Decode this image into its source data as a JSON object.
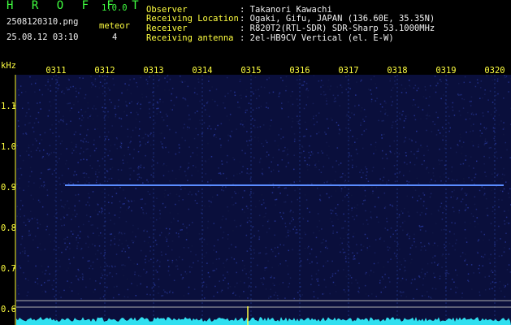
{
  "app": {
    "name": "H R O F F T",
    "version": "1.0.0",
    "file": "2508120310.png",
    "datetime": "25.08.12 03:10",
    "meteor_label": "meteor",
    "meteor_count": "4"
  },
  "info": [
    {
      "label": "Observer",
      "value": ": Takanori Kawachi"
    },
    {
      "label": "Receiving Location",
      "value": ": Ogaki, Gifu, JAPAN (136.60E, 35.35N)"
    },
    {
      "label": "Receiver",
      "value": ": R820T2(RTL-SDR) SDR-Sharp 53.1000MHz"
    },
    {
      "label": "Receiving antenna",
      "value": ": 2el-HB9CV Vertical (el. E-W)"
    }
  ],
  "axis": {
    "y_unit": "kHz",
    "y_ticks": [
      "1.1",
      "1.0",
      "0.9",
      "0.8",
      "0.7",
      "0.6"
    ],
    "x_ticks": [
      "0311",
      "0312",
      "0313",
      "0314",
      "0315",
      "0316",
      "0317",
      "0318",
      "0319",
      "0320"
    ]
  },
  "colors": {
    "background": "#000000",
    "spectrum_bg": "#0a0f3c",
    "carrier": "#5a8cff",
    "noise_trace": "#40ffff",
    "tick_text": "#ffff40"
  }
}
